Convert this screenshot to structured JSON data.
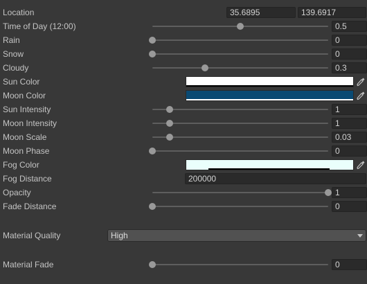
{
  "location": {
    "label": "Location",
    "latitude": "35.6895",
    "longitude": "139.6917"
  },
  "sliders": [
    {
      "id": "time-of-day",
      "label": "Time of Day (12:00)",
      "value": "0.5",
      "fraction": 0.5
    },
    {
      "id": "rain",
      "label": "Rain",
      "value": "0",
      "fraction": 0
    },
    {
      "id": "snow",
      "label": "Snow",
      "value": "0",
      "fraction": 0
    },
    {
      "id": "cloudy",
      "label": "Cloudy",
      "value": "0.3",
      "fraction": 0.3
    }
  ],
  "sun_color": {
    "label": "Sun Color",
    "color": "#ffffff",
    "alpha": 1
  },
  "moon_color": {
    "label": "Moon Color",
    "color": "#0a4a73",
    "alpha": 1
  },
  "sliders2": [
    {
      "id": "sun-intensity",
      "label": "Sun Intensity",
      "value": "1",
      "fraction": 0.1
    },
    {
      "id": "moon-intensity",
      "label": "Moon Intensity",
      "value": "1",
      "fraction": 0.1
    },
    {
      "id": "moon-scale",
      "label": "Moon Scale",
      "value": "0.03",
      "fraction": 0.1
    },
    {
      "id": "moon-phase",
      "label": "Moon Phase",
      "value": "0",
      "fraction": 0
    }
  ],
  "fog_color": {
    "label": "Fog Color",
    "color": "#eafffc",
    "alpha": 0.14
  },
  "fog_distance": {
    "label": "Fog Distance",
    "value": "200000"
  },
  "sliders3": [
    {
      "id": "opacity",
      "label": "Opacity",
      "value": "1",
      "fraction": 1
    },
    {
      "id": "fade-distance",
      "label": "Fade Distance",
      "value": "0",
      "fraction": 0
    }
  ],
  "material_quality": {
    "label": "Material Quality",
    "value": "High"
  },
  "material_fade": {
    "id": "material-fade",
    "label": "Material Fade",
    "value": "0",
    "fraction": 0
  },
  "colors": {
    "background": "#383838",
    "field": "#2a2a2a",
    "track": "#5e5e5e",
    "thumb": "#999999"
  },
  "icons": {
    "picker": "eyedropper-icon",
    "dropdown": "chevron-down-icon"
  }
}
